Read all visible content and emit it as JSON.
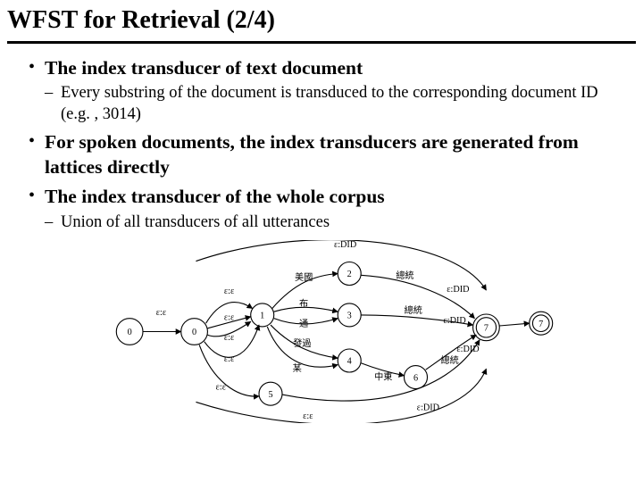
{
  "title": "WFST for Retrieval (2/4)",
  "bullets": {
    "b0": {
      "text": "The index transducer of text document",
      "sub0": "Every substring of the document is transduced to the corresponding document ID (e.g. , 3014)"
    },
    "b1": {
      "text": "For spoken documents, the index transducers are generated from lattices directly"
    },
    "b2": {
      "text": "The index transducer of the whole corpus",
      "sub0": "Union of all transducers of all utterances"
    }
  },
  "diagram": {
    "node0": "0",
    "node0b": "0",
    "node1": "1",
    "node2": "2",
    "node3": "3",
    "node4": "4",
    "node5": "5",
    "node6": "6",
    "node7": "7",
    "node7b": "7",
    "edgeEpsEps": "ε:ε",
    "edgeEpsDID1": "ε:DID",
    "edgeEpsDID2": "ε:DID",
    "edgeEpsDID3": "ε:DID",
    "edgeEpsDID4": "ε:DID",
    "edgeEpsDID5": "ε:DID",
    "edge01a": "ε:ε",
    "edge01b": "ε:ε",
    "edge01c": "ε:ε",
    "edge01d": "ε:ε",
    "edgeBottom": "ε:ε",
    "edge12": "美國",
    "edge13a": "布",
    "edge13b": "通",
    "edge14a": "發過",
    "edge14b": "某",
    "edge27": "總統",
    "edge37": "總統",
    "edge46": "中東",
    "edge67": "總統",
    "edge05": "ε:ε"
  }
}
